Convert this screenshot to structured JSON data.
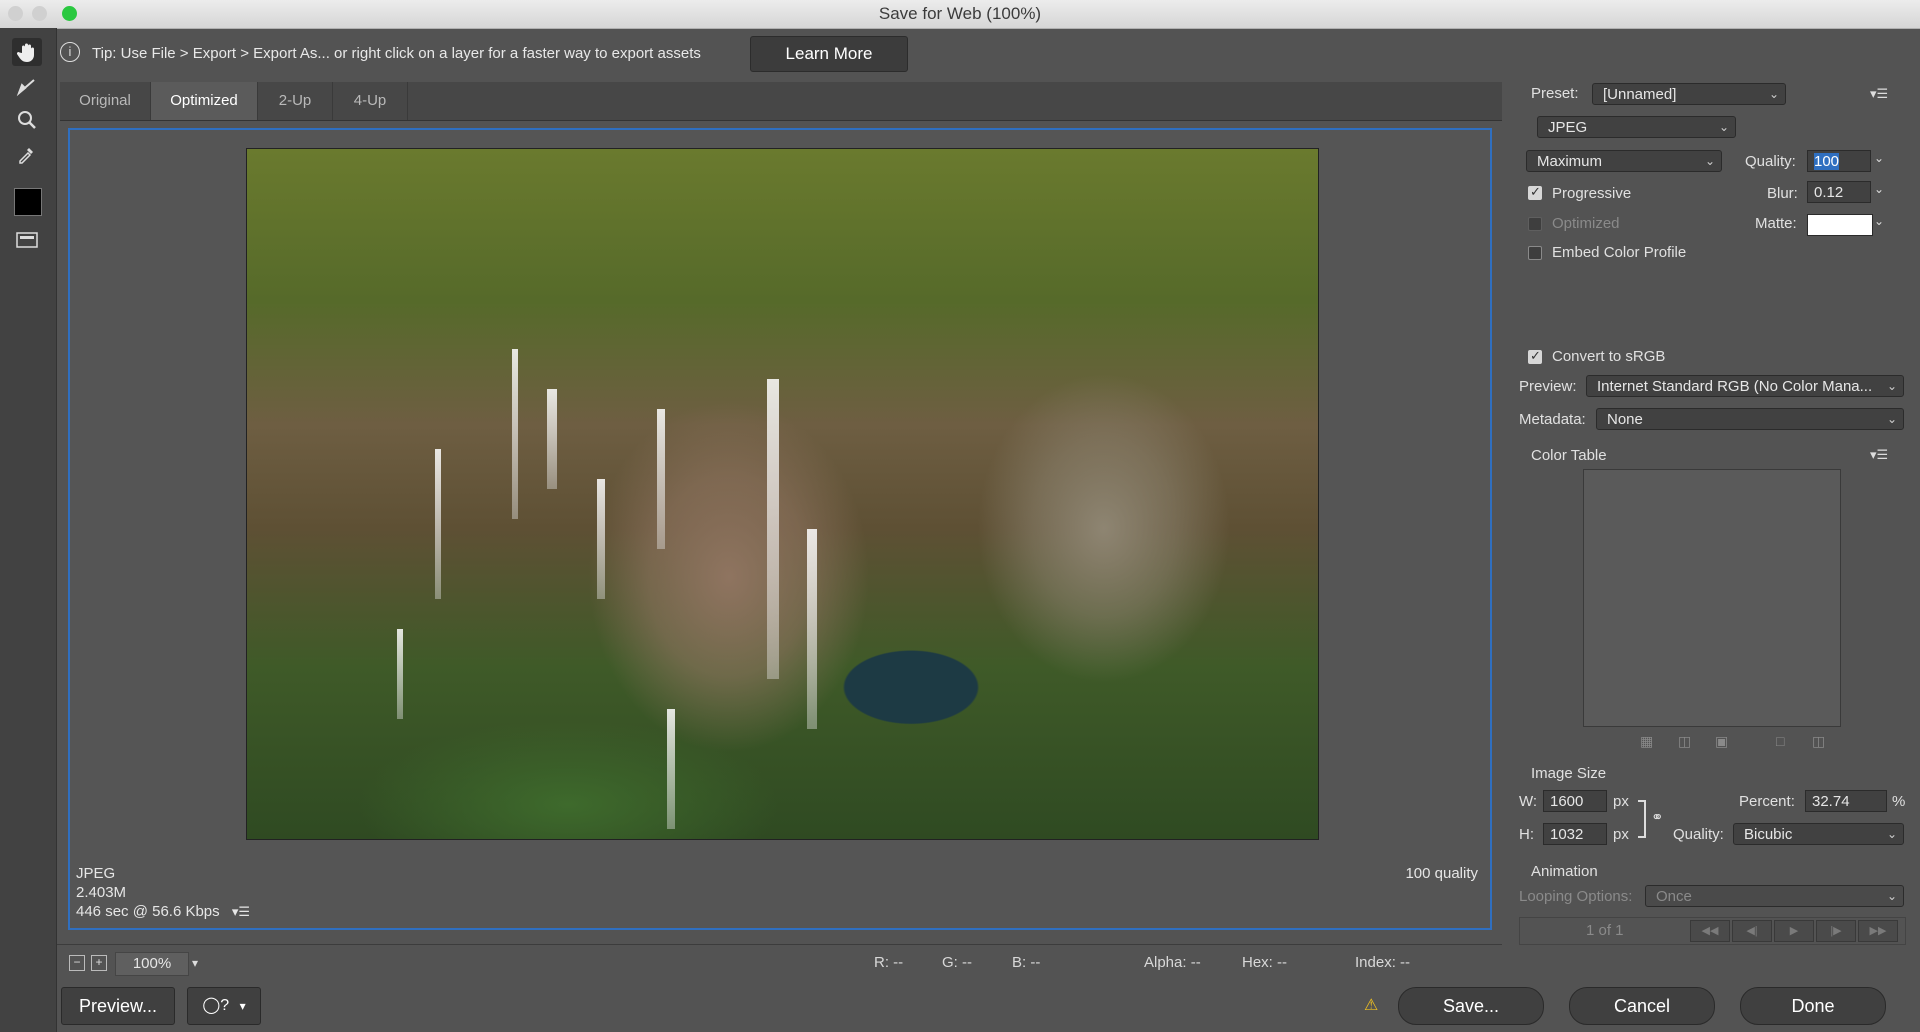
{
  "window": {
    "title": "Save for Web (100%)"
  },
  "tip": {
    "text": "Tip: Use File > Export > Export As...  or right click on a layer for a faster way to export assets",
    "learn_more": "Learn More"
  },
  "tabs": [
    {
      "label": "Original"
    },
    {
      "label": "Optimized"
    },
    {
      "label": "2-Up"
    },
    {
      "label": "4-Up"
    }
  ],
  "active_tab": "Optimized",
  "canvas_status": {
    "format": "JPEG",
    "size": "2.403M",
    "time": "446 sec @ 56.6 Kbps",
    "quality": "100 quality"
  },
  "zoom": {
    "value": "100%"
  },
  "readouts": {
    "r": "R: --",
    "g": "G: --",
    "b": "B: --",
    "alpha": "Alpha: --",
    "hex": "Hex: --",
    "index": "Index: --"
  },
  "footer": {
    "preview": "Preview...",
    "save": "Save...",
    "cancel": "Cancel",
    "done": "Done"
  },
  "settings": {
    "preset_label": "Preset:",
    "preset_value": "[Unnamed]",
    "format": "JPEG",
    "quality_preset": "Maximum",
    "quality_label": "Quality:",
    "quality_value": "100",
    "progressive_label": "Progressive",
    "progressive_checked": true,
    "blur_label": "Blur:",
    "blur_value": "0.12",
    "optimized_label": "Optimized",
    "optimized_checked": false,
    "matte_label": "Matte:",
    "embed_label": "Embed Color Profile",
    "embed_checked": false,
    "convert_label": "Convert to sRGB",
    "convert_checked": true,
    "preview_label": "Preview:",
    "preview_value": "Internet Standard RGB (No Color Mana...",
    "metadata_label": "Metadata:",
    "metadata_value": "None",
    "color_table_label": "Color Table"
  },
  "image_size": {
    "title": "Image Size",
    "w_label": "W:",
    "w_value": "1600",
    "w_unit": "px",
    "h_label": "H:",
    "h_value": "1032",
    "h_unit": "px",
    "percent_label": "Percent:",
    "percent_value": "32.74",
    "percent_unit": "%",
    "quality_label": "Quality:",
    "quality_value": "Bicubic"
  },
  "animation": {
    "title": "Animation",
    "looping_label": "Looping Options:",
    "looping_value": "Once",
    "frame_counter": "1 of 1"
  },
  "colors": {
    "accent": "#2f6fc0",
    "bg": "#535353",
    "matte": "#ffffff"
  }
}
